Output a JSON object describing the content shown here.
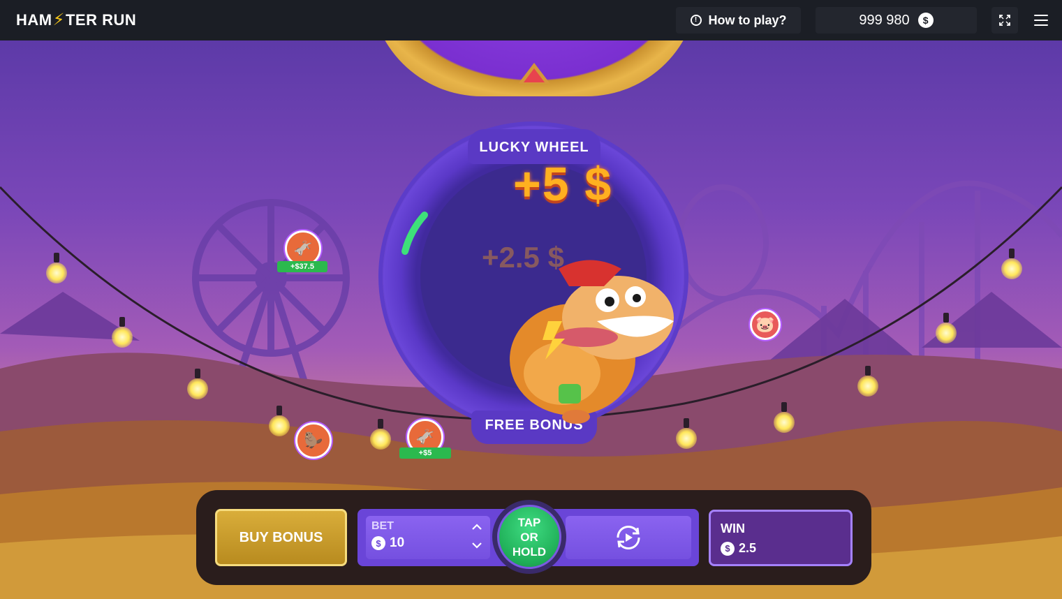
{
  "header": {
    "logo_part1": "HAM",
    "logo_bolt": "⚡",
    "logo_part2": "TER RUN",
    "how_to_play": "How to play?",
    "balance": "999 980",
    "currency_symbol": "$"
  },
  "wheel": {
    "title": "LUCKY WHEEL",
    "subtitle": "FREE BONUS",
    "current_prize": "+5 $",
    "previous_prize": "+2.5 $"
  },
  "players": [
    {
      "name": "donkey-avatar",
      "win": "+$37.5"
    },
    {
      "name": "pig-avatar",
      "win": ""
    },
    {
      "name": "capybara-avatar",
      "win": ""
    },
    {
      "name": "donkey-avatar-2",
      "win": "+$5"
    }
  ],
  "controls": {
    "buy_bonus": "BUY BONUS",
    "bet_label": "BET",
    "bet_value": "10",
    "tap_line1": "TAP",
    "tap_line2": "OR",
    "tap_line3": "HOLD",
    "win_label": "WIN",
    "win_value": "2.5",
    "currency_symbol": "$"
  },
  "colors": {
    "accent_purple": "#6a45d8",
    "tap_green": "#1fae57",
    "gold": "#d9ad3a",
    "win_tag_green": "#2bb94e"
  },
  "icons": [
    "info-icon",
    "coin-icon",
    "fullscreen-icon",
    "menu-icon",
    "chevron-up-icon",
    "chevron-down-icon",
    "autoplay-icon"
  ]
}
